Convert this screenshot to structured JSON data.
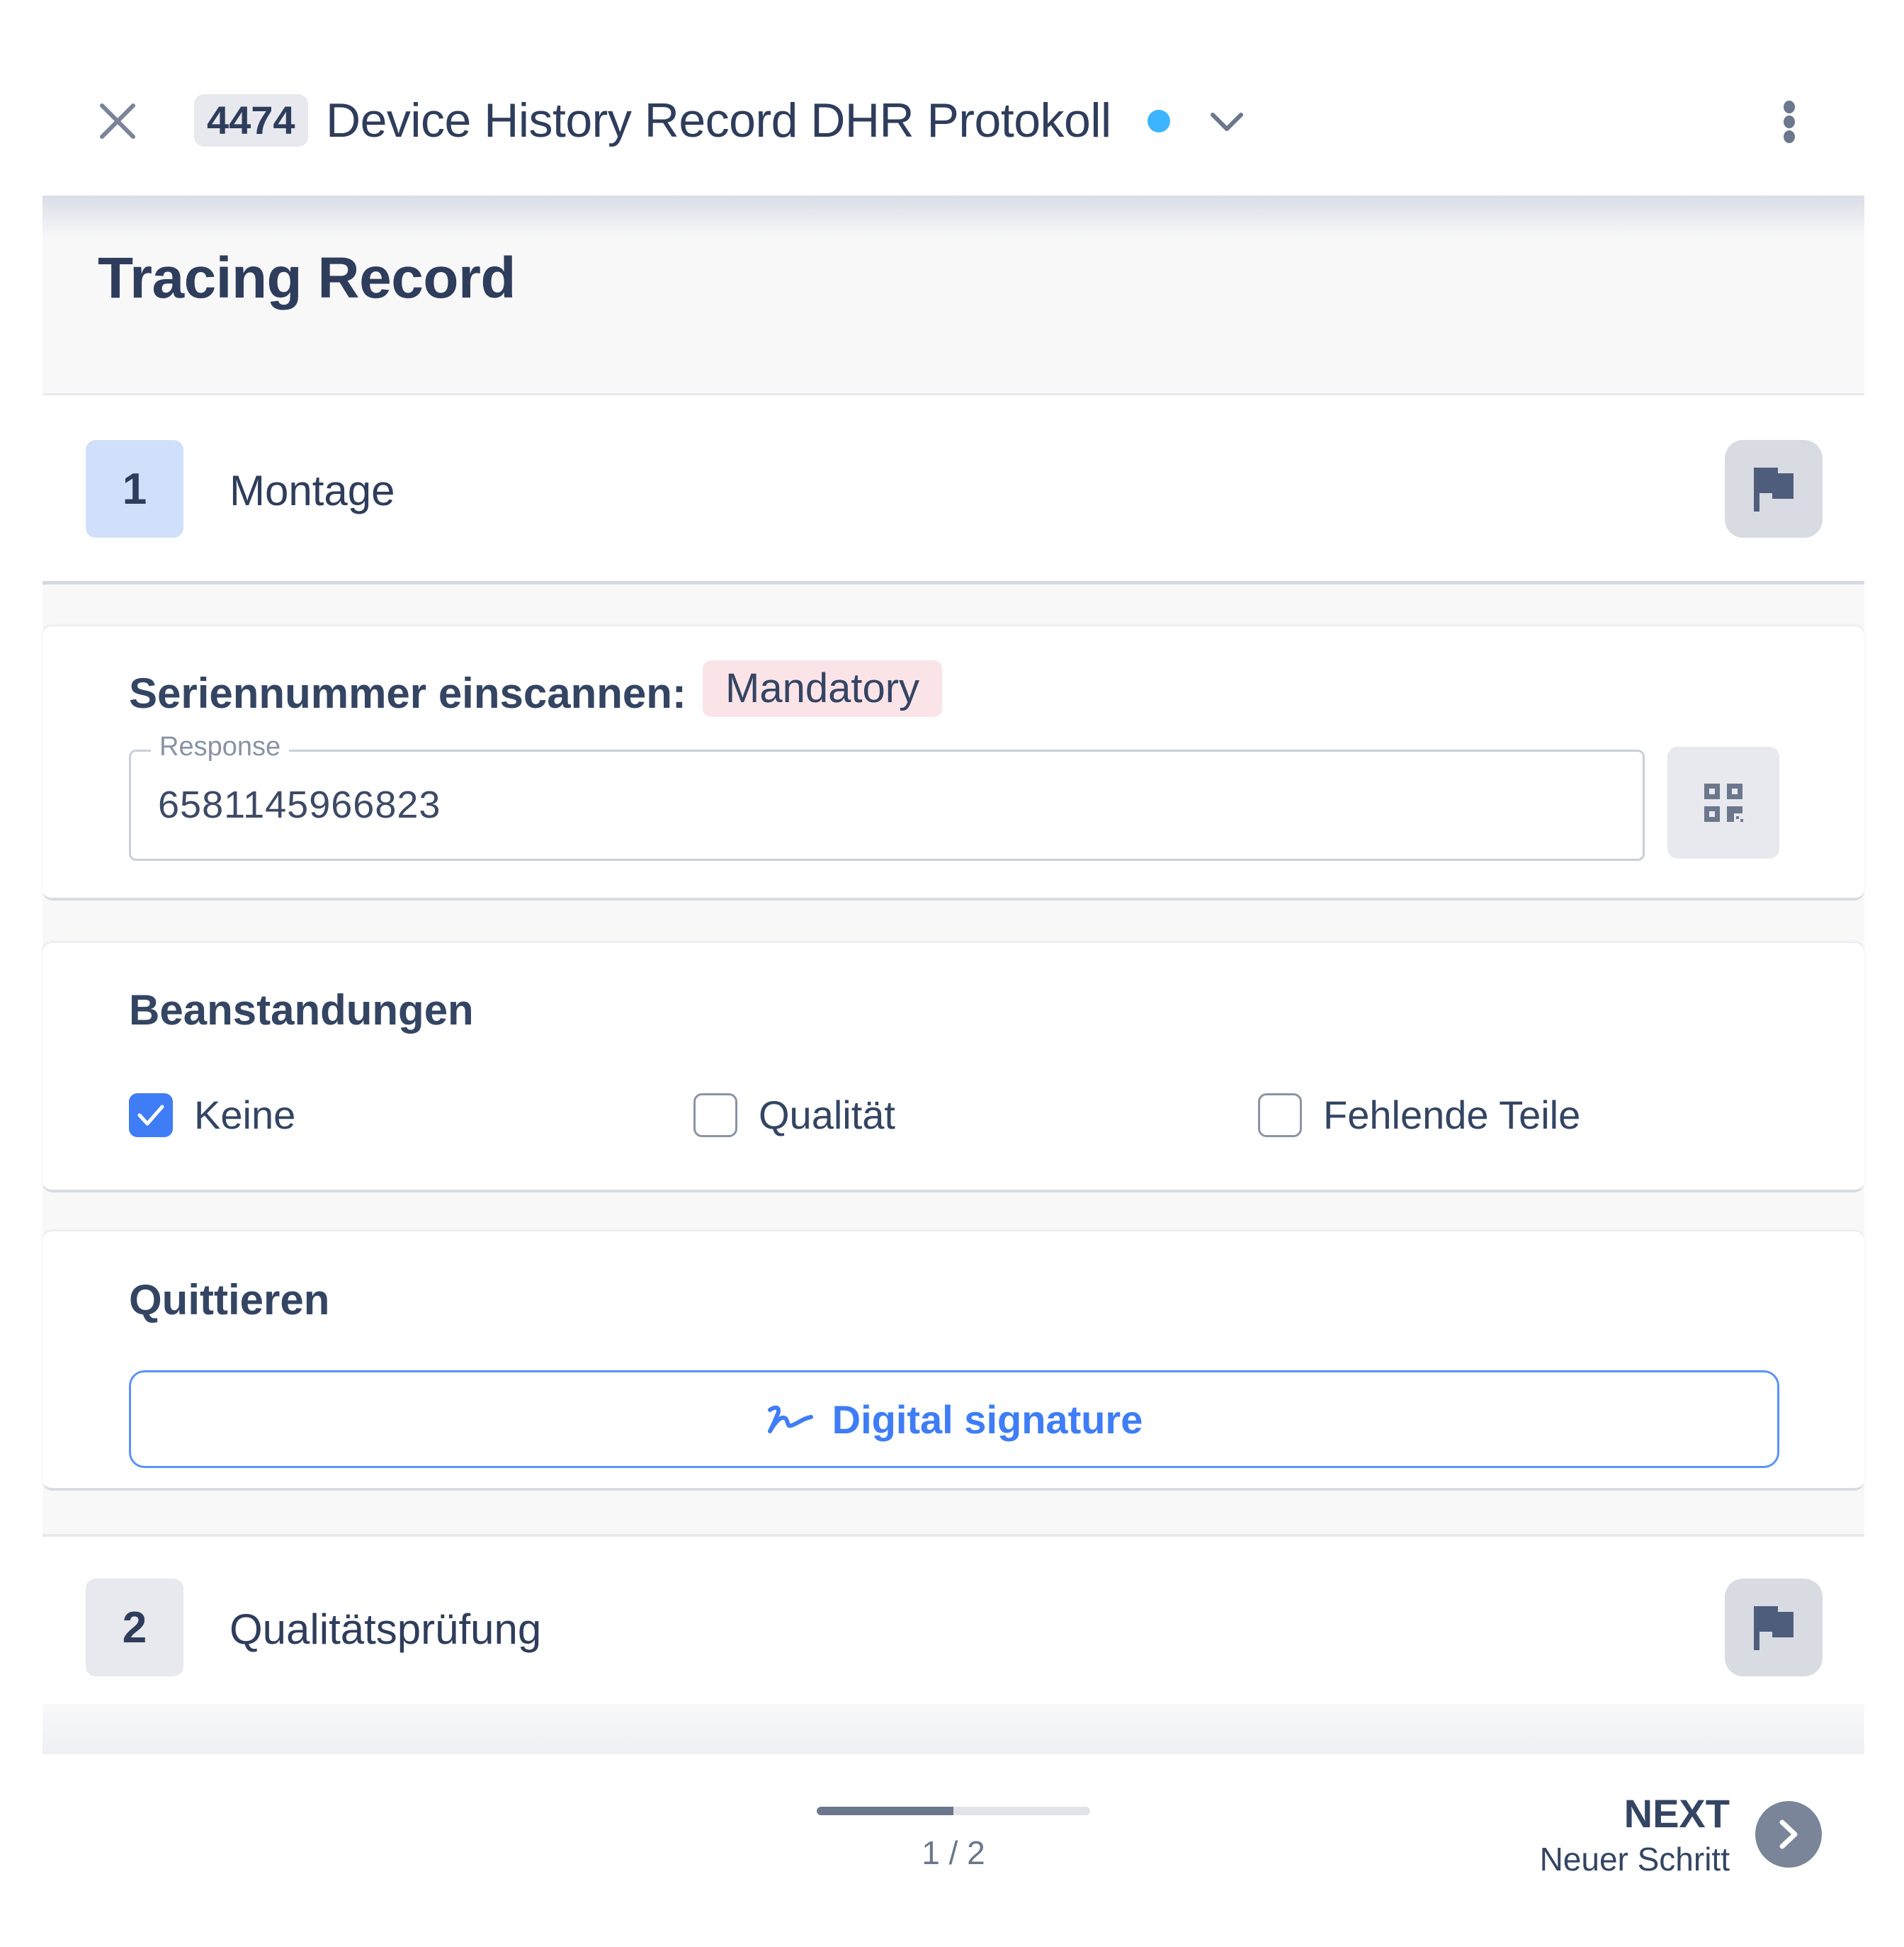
{
  "header": {
    "record_id": "4474",
    "title": "Device History Record DHR Protokoll",
    "status_dot_color": "#3db4ff",
    "icons": {
      "close": "close-icon",
      "expand": "chevron-down-icon",
      "more": "kebab-menu-icon"
    }
  },
  "section": {
    "title": "Tracing Record"
  },
  "steps": [
    {
      "number": "1",
      "name": "Montage",
      "active": true,
      "icon": "flag-icon"
    },
    {
      "number": "2",
      "name": "Qualitätsprüfung",
      "active": false,
      "icon": "flag-icon"
    }
  ],
  "fields": {
    "serial": {
      "label": "Seriennummer einscannen:",
      "badge": "Mandatory",
      "input_legend": "Response",
      "input_value": "6581145966823",
      "scan_icon": "qr-code-icon"
    },
    "complaints": {
      "label": "Beanstandungen",
      "options": [
        {
          "label": "Keine",
          "checked": true
        },
        {
          "label": "Qualität",
          "checked": false
        },
        {
          "label": "Fehlende Teile",
          "checked": false
        }
      ]
    },
    "acknowledge": {
      "label": "Quittieren",
      "button_label": "Digital signature",
      "button_icon": "signature-icon"
    }
  },
  "footer": {
    "progress_fraction": 0.5,
    "page_count": "1 / 2",
    "next_label": "NEXT",
    "next_sublabel": "Neuer Schritt",
    "next_icon": "chevron-right-icon"
  },
  "colors": {
    "accent": "#3f7df6",
    "text": "#344563",
    "step_active_bg": "#d0e0fa",
    "mandatory_bg": "#fbe4e8"
  }
}
